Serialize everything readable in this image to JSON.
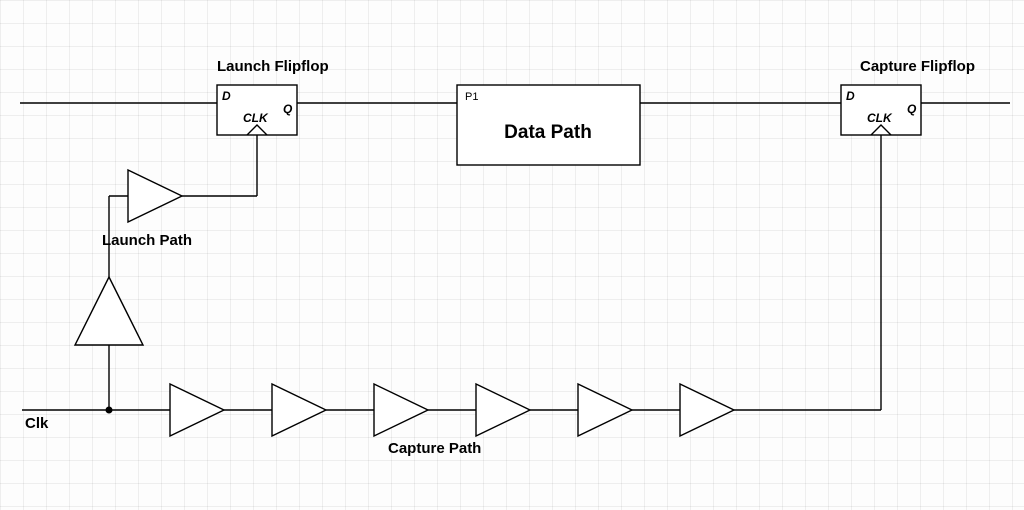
{
  "labels": {
    "launchFlipflop": "Launch Flipflop",
    "captureFlipflop": "Capture Flipflop",
    "dataPath": "Data Path",
    "launchPath": "Launch Path",
    "capturePath": "Capture Path",
    "clk": "Clk",
    "p1": "P1",
    "pinD": "D",
    "pinQ": "Q",
    "pinCLK": "CLK"
  }
}
